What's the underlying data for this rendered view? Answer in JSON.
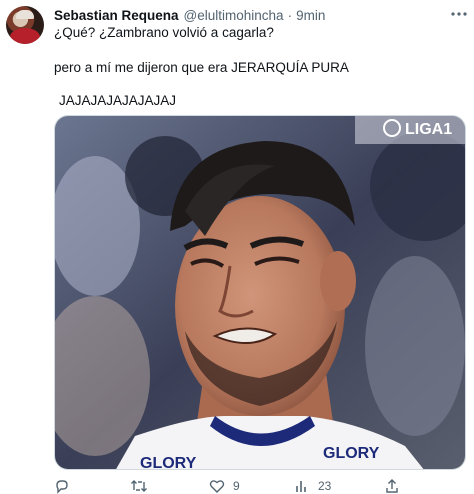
{
  "tweet": {
    "author_name": "Sebastian Requena",
    "handle": "@elultimohincha",
    "separator": "·",
    "time": "9min",
    "text_lines": [
      "¿Qué? ¿Zambrano volvió a cagarla?",
      "pero a mí me dijeron que era JERARQUÍA PURA",
      "JAJAJAJAJAJAJAJ"
    ],
    "media": {
      "overlay_logo": "LIGA1",
      "jersey_text_left": "GLORY",
      "jersey_text_right": "GLORY",
      "colors": {
        "background": "#3a3f57",
        "shirt": "#f4f4f6",
        "skin": "#b7785d",
        "hair": "#1e1a1a"
      }
    },
    "actions": {
      "reply_count": "",
      "retweet_count": "",
      "like_count": "9",
      "views_count": "23"
    },
    "icons": [
      "more-icon",
      "reply-icon",
      "retweet-icon",
      "like-icon",
      "views-icon",
      "share-icon"
    ]
  }
}
